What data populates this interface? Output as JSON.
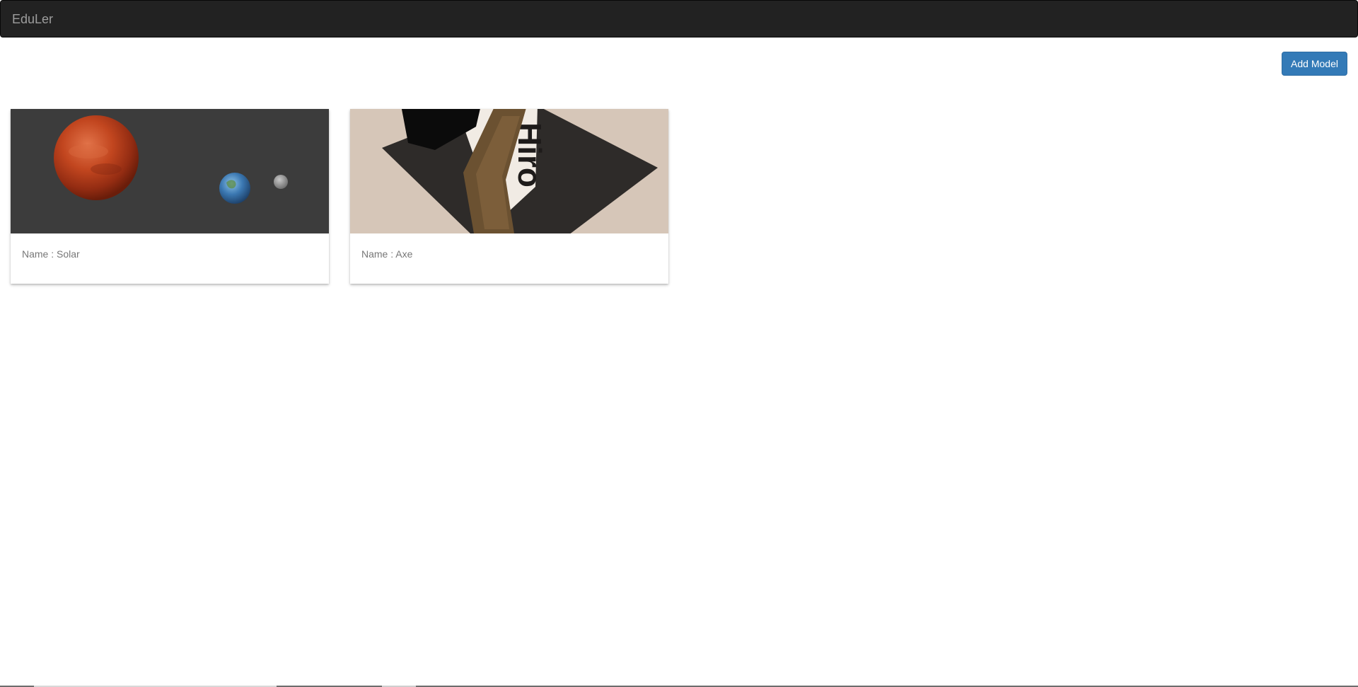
{
  "navbar": {
    "brand": "EduLer"
  },
  "toolbar": {
    "add_model_label": "Add Model"
  },
  "models": [
    {
      "name_label": "Name : Solar",
      "thumbnail": "solar-system-render"
    },
    {
      "name_label": "Name : Axe",
      "thumbnail": "axe-on-hiro-marker"
    }
  ],
  "colors": {
    "navbar_bg": "#222222",
    "brand_text": "#9d9d9d",
    "primary_button": "#337ab7",
    "card_text": "#777777"
  }
}
